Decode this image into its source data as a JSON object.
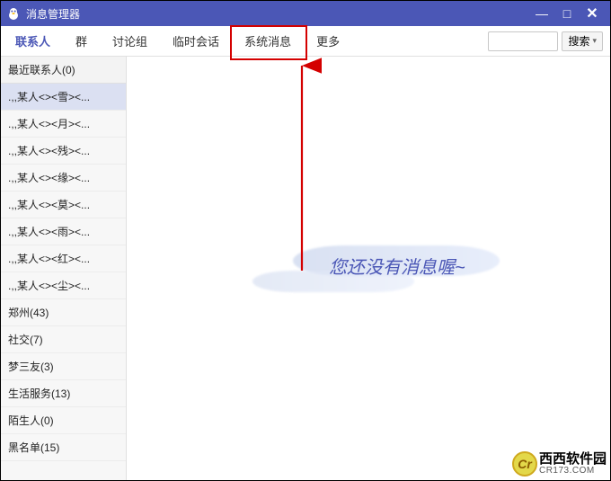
{
  "window": {
    "title": "消息管理器",
    "controls": {
      "min": "—",
      "max": "□",
      "close": "✕"
    }
  },
  "tabs": [
    {
      "label": "联系人",
      "active": true
    },
    {
      "label": "群"
    },
    {
      "label": "讨论组"
    },
    {
      "label": "临时会话"
    },
    {
      "label": "系统消息"
    },
    {
      "label": "更多"
    }
  ],
  "search": {
    "placeholder": "",
    "button_label": "搜索"
  },
  "sidebar": {
    "recent_header": "最近联系人(0)",
    "recent_contacts": [
      ".,,某人<><雪><...",
      ".,,某人<><月><...",
      ".,,某人<><残><...",
      ".,,某人<><缘><...",
      ".,,某人<><莫><...",
      ".,,某人<><雨><...",
      ".,,某人<><红><...",
      ".,,某人<><尘><..."
    ],
    "groups": [
      {
        "label": "郑州(43)"
      },
      {
        "label": "社交(7)"
      },
      {
        "label": "梦三友(3)"
      },
      {
        "label": "生活服务(13)"
      },
      {
        "label": "陌生人(0)"
      },
      {
        "label": "黑名单(15)"
      }
    ]
  },
  "main": {
    "empty_text": "您还没有消息喔~"
  },
  "annotation": {
    "highlight_target_tab_index": 4,
    "colors": {
      "highlight": "#d40000",
      "arrow": "#d40000"
    }
  },
  "watermark": {
    "logo_text": "Cr",
    "row1": "西西软件园",
    "row2": "CR173.COM"
  }
}
